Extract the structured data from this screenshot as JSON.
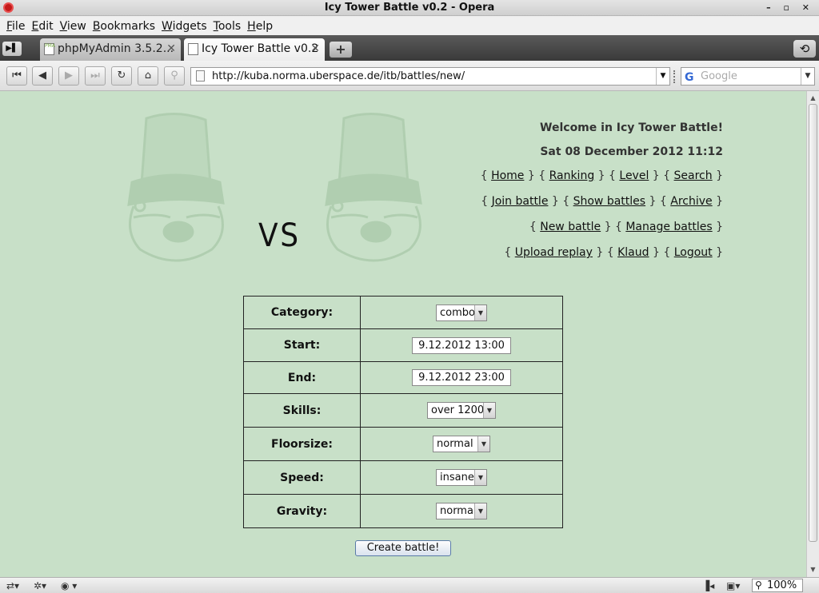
{
  "window": {
    "title": "Icy Tower Battle v0.2 - Opera",
    "controls": "– ▫ ✕"
  },
  "menu": [
    {
      "key": "F",
      "rest": "ile"
    },
    {
      "key": "E",
      "rest": "dit"
    },
    {
      "key": "V",
      "rest": "iew"
    },
    {
      "key": "B",
      "rest": "ookmarks"
    },
    {
      "key": "W",
      "rest": "idgets"
    },
    {
      "key": "T",
      "rest": "ools"
    },
    {
      "key": "H",
      "rest": "elp"
    }
  ],
  "tabs": [
    {
      "label": "phpMyAdmin 3.5.2...",
      "icon_text": "PMA"
    },
    {
      "label": "Icy Tower Battle v0.2"
    }
  ],
  "tab_close_glyph": "✕",
  "new_tab_glyph": "+",
  "address": {
    "url": "http://kuba.norma.uberspace.de/itb/battles/new/"
  },
  "search": {
    "engine_glyph": "G",
    "placeholder": "Google"
  },
  "page": {
    "vs": "VS",
    "welcome": "Welcome in Icy Tower Battle!",
    "datetime": "Sat 08 December 2012 11:12",
    "nav_rows": [
      [
        "Home",
        "Ranking",
        "Level",
        "Search"
      ],
      [
        "Join battle",
        "Show battles",
        "Archive"
      ],
      [
        "New battle",
        "Manage battles"
      ],
      [
        "Upload replay",
        "Klaud",
        "Logout"
      ]
    ],
    "form": {
      "category_label": "Category:",
      "category_value": "combo",
      "start_label": "Start:",
      "start_value": "9.12.2012 13:00",
      "end_label": "End:",
      "end_value": "9.12.2012 23:00",
      "skills_label": "Skills:",
      "skills_value": "over 1200",
      "floorsize_label": "Floorsize:",
      "floorsize_value": "normal",
      "speed_label": "Speed:",
      "speed_value": "insane",
      "gravity_label": "Gravity:",
      "gravity_value": "normal",
      "submit_label": "Create battle!"
    }
  },
  "statusbar": {
    "zoom": "100%"
  },
  "colors": {
    "page_bg": "#c8e0c8",
    "mascot": "#b0ceb0",
    "tab_bar": "#4a4a4a"
  }
}
